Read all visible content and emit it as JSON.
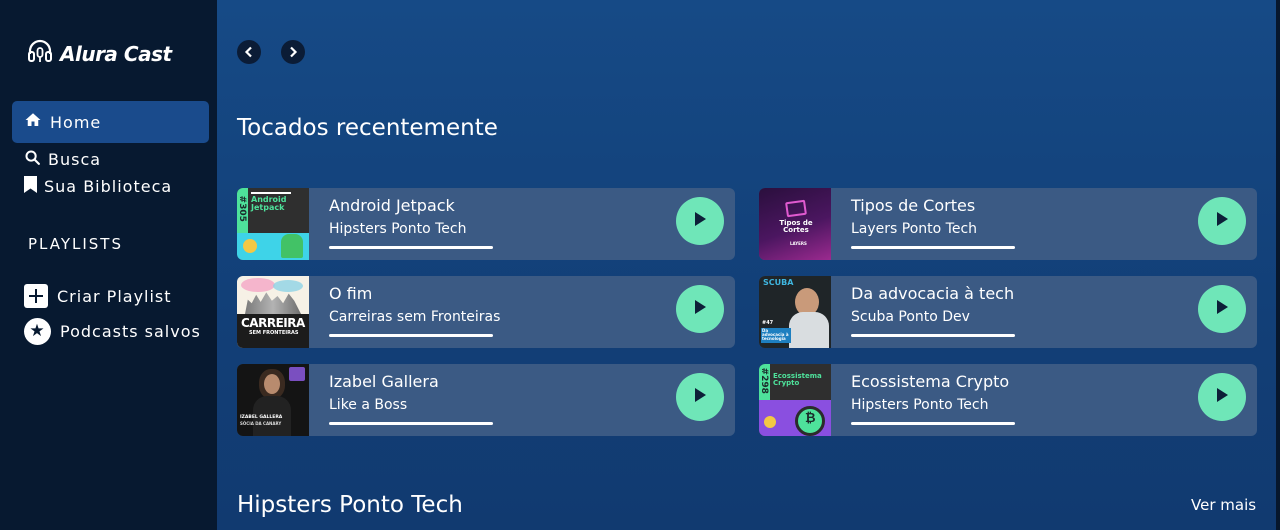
{
  "sidebar": {
    "logo_text": "Alura Cast",
    "nav": {
      "home": "Home",
      "search": "Busca",
      "library": "Sua Biblioteca"
    },
    "playlists_title": "PLAYLISTS",
    "create_playlist": "Criar Playlist",
    "saved_podcasts": "Podcasts salvos"
  },
  "main": {
    "recent_title": "Tocados recentemente",
    "section2_title": "Hipsters Ponto Tech",
    "see_more": "Ver mais",
    "recent": [
      {
        "title": "Android Jetpack",
        "show": "Hipsters Ponto Tech",
        "art": {
          "tag": "#305",
          "label": "Android Jetpack"
        }
      },
      {
        "title": "Tipos de Cortes",
        "show": "Layers Ponto Tech",
        "art": {
          "label": "Tipos de Cortes",
          "brand": "LAYERS"
        }
      },
      {
        "title": "O fim",
        "show": "Carreiras sem Fronteiras",
        "art": {
          "label": "CARREIRA",
          "sub": "SEM FRONTEIRAS"
        }
      },
      {
        "title": "Da advocacia à tech",
        "show": "Scuba Ponto Dev",
        "art": {
          "brand": "SCUBA",
          "tag": "#47",
          "label": "Da advocacia à tecnologia"
        }
      },
      {
        "title": "Izabel Gallera",
        "show": "Like a Boss",
        "art": {
          "label": "IZABEL GALLERA",
          "sub": "SÓCIA DA CANARY"
        }
      },
      {
        "title": "Ecossistema Crypto",
        "show": "Hipsters Ponto Tech",
        "art": {
          "tag": "#298",
          "label": "Ecossistema Crypto"
        }
      }
    ]
  },
  "colors": {
    "accent_play": "#6fe6b8",
    "card_bg": "#3b5a84",
    "sidebar_bg": "#071930",
    "active_nav": "#1a4b8c"
  },
  "icons": [
    "headphones-logo-icon",
    "home-icon",
    "search-icon",
    "bookmark-icon",
    "plus-icon",
    "star-icon",
    "chevron-left-icon",
    "chevron-right-icon",
    "play-icon"
  ]
}
